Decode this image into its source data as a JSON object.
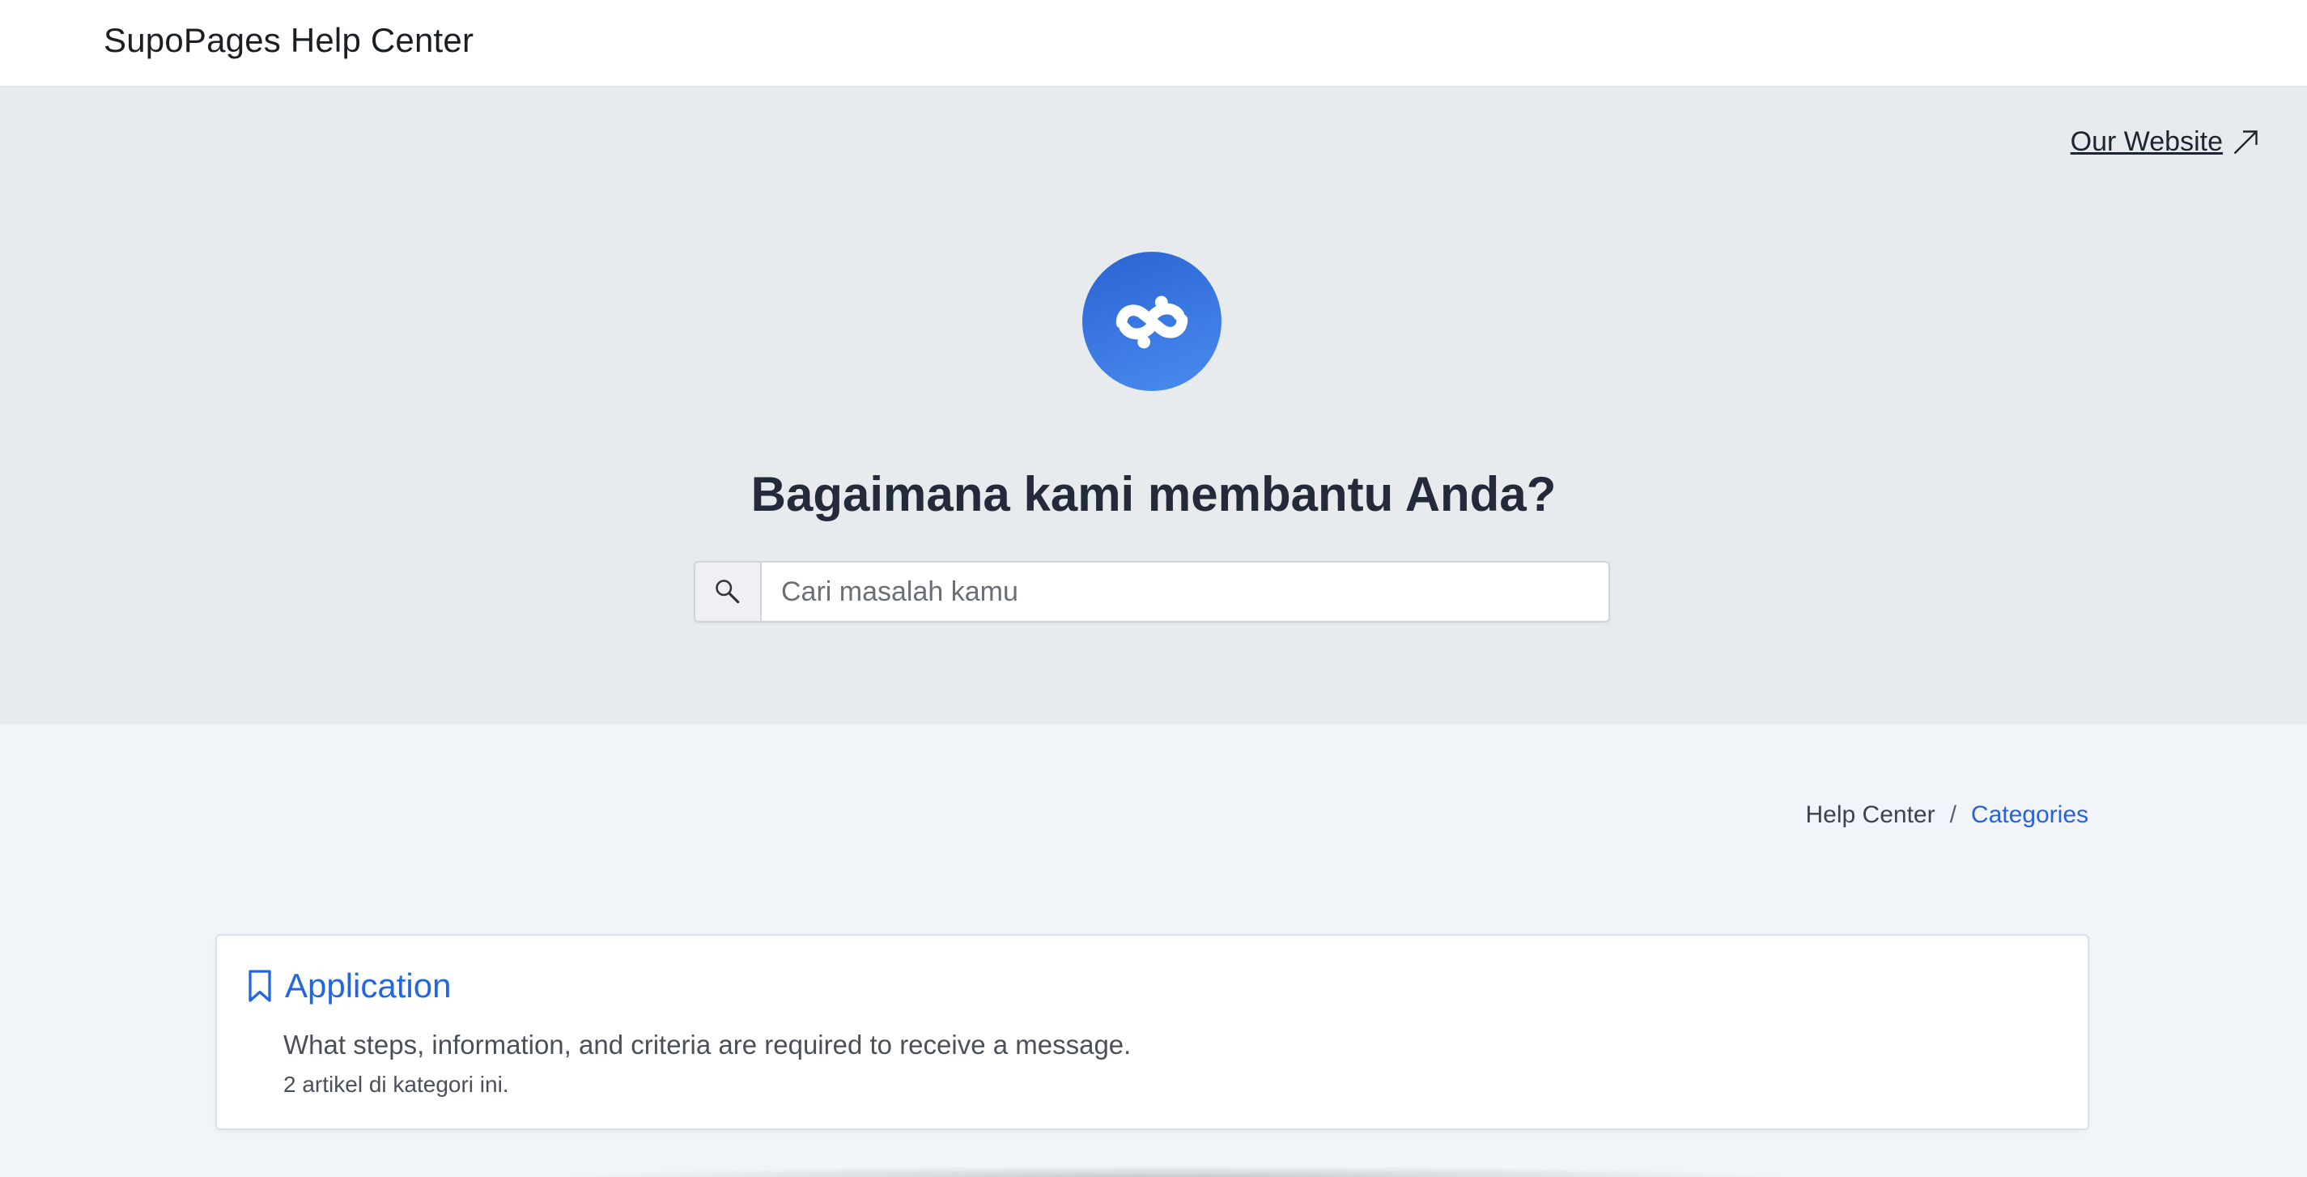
{
  "header": {
    "brand": "SupoPages Help Center"
  },
  "hero": {
    "external_link": "Our Website",
    "title": "Bagaimana kami membantu Anda?",
    "search": {
      "placeholder": "Cari masalah kamu",
      "value": ""
    }
  },
  "breadcrumb": {
    "home": "Help Center",
    "separator": "/",
    "current": "Categories"
  },
  "categories": [
    {
      "icon": "bookmark-icon",
      "title": "Application",
      "description": "What steps, information, and criteria are required to receive a message.",
      "count_text": "2 artikel di kategori ini."
    }
  ],
  "colors": {
    "accent": "#2267e0",
    "logo_gradient_start": "#2a63d2",
    "logo_gradient_end": "#4a8cf0",
    "hero_bg": "#e8ebee",
    "page_bg": "#f1f4f8",
    "title_text": "#232a3a"
  }
}
